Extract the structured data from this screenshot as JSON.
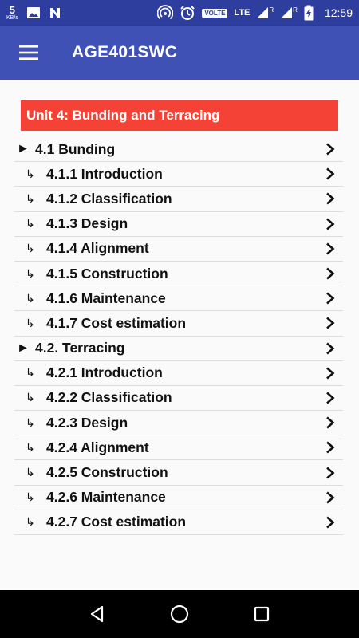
{
  "status_bar": {
    "net_speed": "5",
    "net_unit": "KB/s",
    "volte": "VOLTE",
    "lte": "LTE",
    "roaming_1": "R",
    "roaming_2": "R",
    "time": "12:59"
  },
  "app_bar": {
    "title": "AGE401SWC"
  },
  "unit": {
    "title": "Unit 4: Bunding and Terracing",
    "color": "#f44336"
  },
  "toc": [
    {
      "level": "section",
      "marker": "►",
      "label": "4.1 Bunding"
    },
    {
      "level": "sub",
      "marker": "↳",
      "label": "4.1.1 Introduction"
    },
    {
      "level": "sub",
      "marker": "↳",
      "label": "4.1.2 Classification"
    },
    {
      "level": "sub",
      "marker": "↳",
      "label": "4.1.3 Design"
    },
    {
      "level": "sub",
      "marker": "↳",
      "label": "4.1.4 Alignment"
    },
    {
      "level": "sub",
      "marker": "↳",
      "label": "4.1.5 Construction"
    },
    {
      "level": "sub",
      "marker": "↳",
      "label": "4.1.6 Maintenance"
    },
    {
      "level": "sub",
      "marker": "↳",
      "label": "4.1.7 Cost estimation"
    },
    {
      "level": "section",
      "marker": "►",
      "label": "4.2. Terracing"
    },
    {
      "level": "sub",
      "marker": "↳",
      "label": "4.2.1 Introduction"
    },
    {
      "level": "sub",
      "marker": "↳",
      "label": "4.2.2 Classification"
    },
    {
      "level": "sub",
      "marker": "↳",
      "label": "4.2.3 Design"
    },
    {
      "level": "sub",
      "marker": "↳",
      "label": "4.2.4 Alignment"
    },
    {
      "level": "sub",
      "marker": "↳",
      "label": "4.2.5 Construction"
    },
    {
      "level": "sub",
      "marker": "↳",
      "label": "4.2.6 Maintenance"
    },
    {
      "level": "sub",
      "marker": "↳",
      "label": "4.2.7 Cost estimation"
    }
  ],
  "icons": {
    "menu": "hamburger-menu-icon",
    "chevron": "chevron-right-icon",
    "back": "back-triangle-icon",
    "home": "home-circle-icon",
    "recents": "recents-square-icon"
  },
  "colors": {
    "status_bar": "#2d3e9e",
    "app_bar": "#3f51b5",
    "accent_red": "#f44336"
  }
}
